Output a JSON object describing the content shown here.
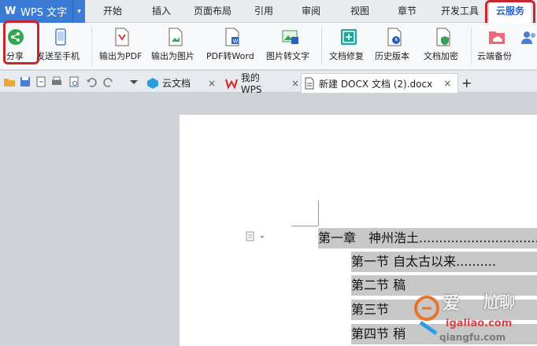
{
  "app": {
    "name": "WPS 文字",
    "logo": "W"
  },
  "menu": {
    "items": [
      "开始",
      "插入",
      "页面布局",
      "引用",
      "审阅",
      "视图",
      "章节",
      "开发工具",
      "云服务"
    ],
    "active": "云服务"
  },
  "ribbon": {
    "buttons": [
      {
        "label": "分享",
        "icon": "share-icon"
      },
      {
        "label": "发送至手机",
        "icon": "phone-icon"
      },
      {
        "label": "输出为PDF",
        "icon": "pdf-export-icon"
      },
      {
        "label": "输出为图片",
        "icon": "image-export-icon"
      },
      {
        "label": "PDF转Word",
        "icon": "pdf-to-word-icon"
      },
      {
        "label": "图片转文字",
        "icon": "image-to-text-icon"
      },
      {
        "label": "文档修复",
        "icon": "doc-repair-icon"
      },
      {
        "label": "历史版本",
        "icon": "history-icon"
      },
      {
        "label": "文档加密",
        "icon": "doc-encrypt-icon"
      },
      {
        "label": "云端备份",
        "icon": "cloud-backup-icon"
      }
    ]
  },
  "tabs": {
    "items": [
      {
        "label": "云文档",
        "icon": "cloud-doc-icon"
      },
      {
        "label": "我的WPS",
        "icon": "wps-logo-icon"
      },
      {
        "label": "新建 DOCX 文档 (2).docx",
        "icon": "docx-icon"
      }
    ],
    "close_glyph": "×",
    "new_tab_glyph": "+"
  },
  "document": {
    "toc": [
      "第一章　神州浩土..............................",
      "第一节 自太古以来..........",
      "第二节 ",
      "第三节",
      "第四节 "
    ],
    "toc_tail": {
      "line2_char": "稿",
      "line5_char": "稍"
    }
  },
  "watermark": {
    "text1": "爱",
    "text2": "尬聊",
    "text3": "igaliao.com",
    "text4": "qiangfu.com"
  },
  "colors": {
    "accent": "#2b62c2",
    "highlight_box": "#c8252c",
    "selection": "#c7c7c7"
  }
}
